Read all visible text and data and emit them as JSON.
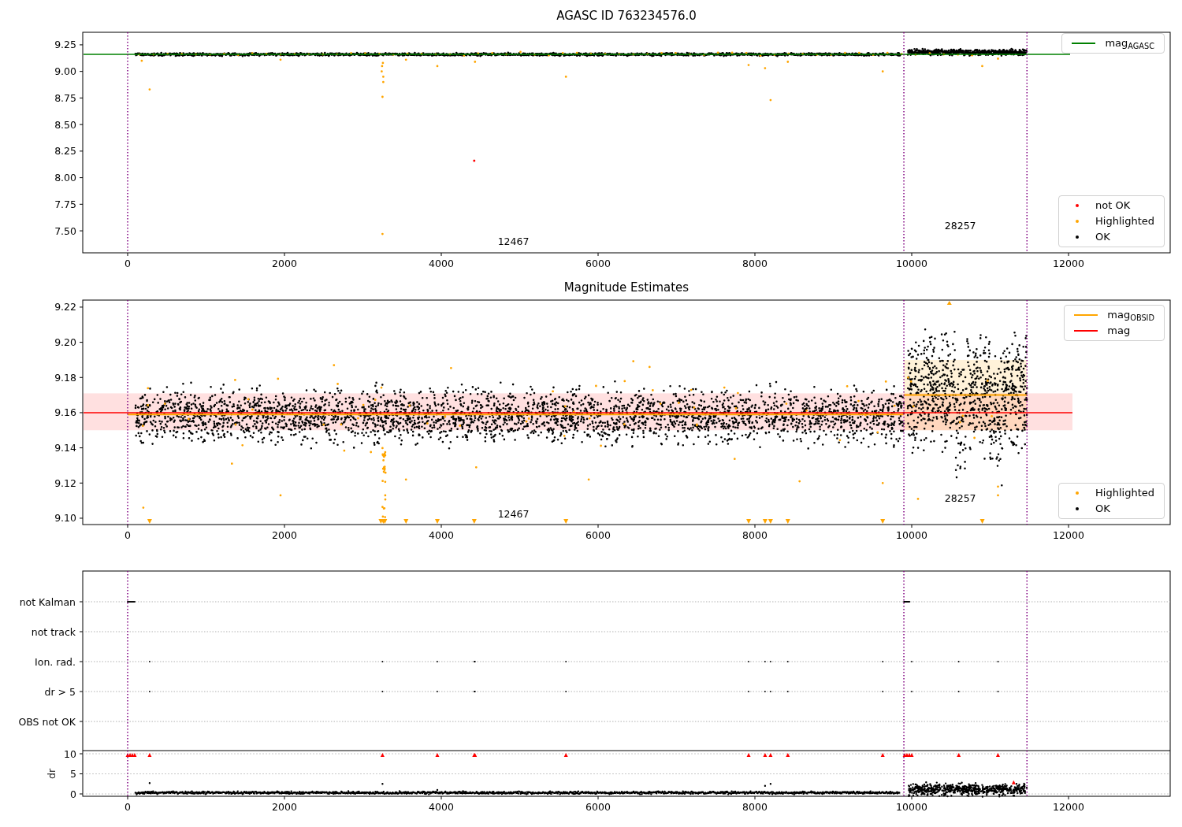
{
  "panels": [
    {
      "kind": "magnitude",
      "title": "AGASC ID 763234576.0",
      "xticks": [
        "0",
        "2000",
        "4000",
        "6000",
        "8000",
        "10000",
        "12000"
      ],
      "yticks": [
        "9.25",
        "9.00",
        "8.75",
        "8.50",
        "8.25",
        "8.00",
        "7.75",
        "7.50"
      ],
      "annotations": [
        {
          "text": "12467"
        },
        {
          "text": "28257"
        }
      ],
      "legends": [
        {
          "items": [
            {
              "kind": "line",
              "label": "mag$_{AGASC}$",
              "color": "#008000"
            }
          ]
        },
        {
          "items": [
            {
              "kind": "dot",
              "label": "not OK",
              "color": "#ff0000"
            },
            {
              "kind": "dot",
              "label": "Highlighted",
              "color": "#ffa500"
            },
            {
              "kind": "dot",
              "label": "OK",
              "color": "#000000"
            }
          ]
        }
      ]
    },
    {
      "kind": "estimates",
      "title": "Magnitude Estimates",
      "xticks": [
        "0",
        "2000",
        "4000",
        "6000",
        "8000",
        "10000",
        "12000"
      ],
      "yticks": [
        "9.22",
        "9.20",
        "9.18",
        "9.16",
        "9.14",
        "9.12",
        "9.10"
      ],
      "annotations": [
        {
          "text": "12467"
        },
        {
          "text": "28257"
        }
      ],
      "legends": [
        {
          "items": [
            {
              "kind": "line",
              "label": "mag$_{OBSID}$",
              "color": "#ffa500"
            },
            {
              "kind": "line",
              "label": "mag",
              "color": "#ff0000"
            }
          ]
        },
        {
          "items": [
            {
              "kind": "dot",
              "label": "Highlighted",
              "color": "#ffa500"
            },
            {
              "kind": "dot",
              "label": "OK",
              "color": "#000000"
            }
          ]
        }
      ]
    },
    {
      "kind": "flags",
      "xticks": [
        "0",
        "2000",
        "4000",
        "6000",
        "8000",
        "10000",
        "12000"
      ],
      "categories": [
        "not Kalman",
        "not track",
        "Ion. rad.",
        "dr > 5",
        "OBS not OK"
      ],
      "ylabel": "dr",
      "yticks": [
        "10",
        "5",
        "0"
      ]
    }
  ]
}
